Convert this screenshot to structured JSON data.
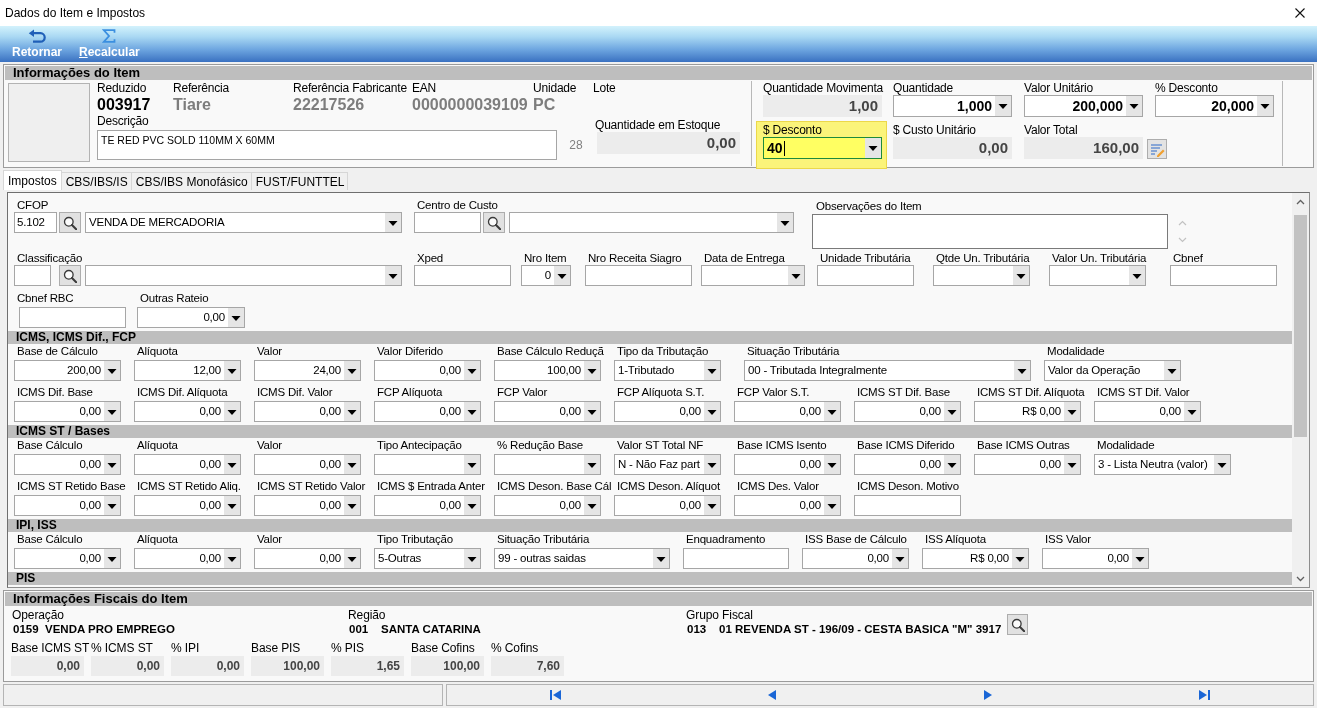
{
  "window": {
    "title": "Dados do Item e Impostos"
  },
  "toolbar": [
    {
      "kind": "return",
      "label": "Retornar",
      "accelerator": false
    },
    {
      "kind": "sum",
      "label": "Recalcular",
      "accelerator": true
    }
  ],
  "item_info": {
    "title": "Informações do Item",
    "identifiers": [
      {
        "label": "Reduzido",
        "value": "003917",
        "emphasis": true
      },
      {
        "label": "Referência",
        "value": "Tiare",
        "emphasis": false
      },
      {
        "label": "Referência Fabricante",
        "value": "22217526",
        "emphasis": false
      },
      {
        "label": "EAN",
        "value": "0000000039109",
        "emphasis": false
      },
      {
        "label": "Unidade",
        "value": "PC",
        "emphasis": false
      },
      {
        "label": "Lote"
      }
    ],
    "description": {
      "label": "Descrição",
      "value": "TE RED PVC SOLD 110MM X 60MM",
      "length": "28"
    },
    "stock": {
      "label": "Quantidade em Estoque",
      "value": "0,00"
    },
    "amounts": [
      {
        "kind": "readonly",
        "label": "Quantidade Movimenta",
        "value": "1,00",
        "focused": false
      },
      {
        "kind": "spin",
        "label": "Quantidade",
        "value": "1,000",
        "focused": false
      },
      {
        "kind": "spin",
        "label": "Valor Unitário",
        "value": "200,000",
        "focused": false
      },
      {
        "kind": "spin",
        "label": "% Desconto",
        "value": "20,000",
        "focused": false
      },
      {
        "kind": "spin",
        "label": "$ Desconto",
        "value": "40",
        "focused": true
      },
      {
        "kind": "readonly",
        "label": "$ Custo Unitário",
        "value": "0,00",
        "focused": false
      },
      {
        "kind": "total",
        "label": "Valor Total",
        "value": "160,00",
        "focused": false
      }
    ]
  },
  "tabs": [
    {
      "label": "Impostos",
      "selected": true
    },
    {
      "label": "CBS/IBS/IS",
      "selected": false
    },
    {
      "label": "CBS/IBS Monofásico",
      "selected": false
    },
    {
      "label": "FUST/FUNTTEL",
      "selected": false
    }
  ],
  "taxes": {
    "general": [
      [
        {
          "kind": "lookup",
          "label": "CFOP",
          "code": "5.102",
          "value": "VENDA DE MERCADORIA"
        },
        {
          "kind": "lookup",
          "label": "Centro de Custo"
        },
        {
          "kind": "memo",
          "label": "Observações do Item"
        }
      ],
      [
        {
          "kind": "lookup",
          "label": "Classificação"
        },
        {
          "kind": "input",
          "label": "Xped"
        },
        {
          "kind": "spin",
          "label": "Nro Item",
          "value": "0"
        },
        {
          "kind": "input",
          "label": "Nro Receita Siagro"
        },
        {
          "kind": "select",
          "label": "Data de Entrega"
        },
        {
          "kind": "input",
          "label": "Unidade Tributária"
        },
        {
          "kind": "select",
          "label": "Qtde Un. Tributária"
        },
        {
          "kind": "select",
          "label": "Valor Un. Tributária"
        },
        {
          "kind": "input",
          "label": "Cbnef"
        }
      ],
      [
        {
          "kind": "input",
          "label": "Cbnef RBC"
        },
        {
          "kind": "spin",
          "label": "Outras Rateio",
          "value": "0,00"
        }
      ]
    ],
    "sections": [
      {
        "title": "ICMS, ICMS Dif., FCP",
        "rows": [
          [
            {
              "kind": "spin",
              "label": "Base de Cálculo",
              "value": "200,00"
            },
            {
              "kind": "spin",
              "label": "Alíquota",
              "value": "12,00"
            },
            {
              "kind": "spin",
              "label": "Valor",
              "value": "24,00"
            },
            {
              "kind": "spin",
              "label": "Valor Diferido",
              "value": "0,00"
            },
            {
              "kind": "spin",
              "label": "Base Cálculo Reduçã",
              "value": "100,00"
            },
            {
              "kind": "select",
              "label": "Tipo da Tributação",
              "value": "1-Tributado"
            },
            {
              "kind": "select",
              "label": "Situação Tributária",
              "value": "00 - Tributada Integralmente"
            },
            {
              "kind": "select",
              "label": "Modalidade",
              "value": "Valor da Operação"
            }
          ],
          [
            {
              "kind": "spin",
              "label": "ICMS Dif. Base",
              "value": "0,00"
            },
            {
              "kind": "spin",
              "label": "ICMS Dif. Alíquota",
              "value": "0,00"
            },
            {
              "kind": "spin",
              "label": "ICMS Dif. Valor",
              "value": "0,00"
            },
            {
              "kind": "spin",
              "label": "FCP Alíquota",
              "value": "0,00"
            },
            {
              "kind": "spin",
              "label": "FCP Valor",
              "value": "0,00"
            },
            {
              "kind": "spin",
              "label": "FCP Alíquota S.T.",
              "value": "0,00"
            },
            {
              "kind": "spin",
              "label": "FCP Valor S.T.",
              "value": "0,00"
            },
            {
              "kind": "spin",
              "label": "ICMS ST Dif. Base",
              "value": "0,00"
            },
            {
              "kind": "spin",
              "label": "ICMS ST Dif. Alíquota",
              "value": "R$ 0,00"
            },
            {
              "kind": "spin",
              "label": "ICMS ST Dif. Valor",
              "value": "0,00"
            }
          ]
        ]
      },
      {
        "title": "ICMS ST / Bases",
        "rows": [
          [
            {
              "kind": "spin",
              "label": "Base Cálculo",
              "value": "0,00"
            },
            {
              "kind": "spin",
              "label": "Alíquota",
              "value": "0,00"
            },
            {
              "kind": "spin",
              "label": "Valor",
              "value": "0,00"
            },
            {
              "kind": "select",
              "label": "Tipo Antecipação"
            },
            {
              "kind": "select",
              "label": "% Redução Base"
            },
            {
              "kind": "select",
              "label": "Valor ST Total NF",
              "value": "N - Não Faz part"
            },
            {
              "kind": "spin",
              "label": "Base ICMS Isento",
              "value": "0,00"
            },
            {
              "kind": "spin",
              "label": "Base ICMS Diferido",
              "value": "0,00"
            },
            {
              "kind": "spin",
              "label": "Base ICMS Outras",
              "value": "0,00"
            },
            {
              "kind": "select",
              "label": "Modalidade",
              "value": "3 - Lista Neutra (valor)"
            }
          ],
          [
            {
              "kind": "spin",
              "label": "ICMS ST Retido Base",
              "value": "0,00"
            },
            {
              "kind": "spin",
              "label": "ICMS ST Retido Aliq.",
              "value": "0,00"
            },
            {
              "kind": "spin",
              "label": "ICMS ST Retido Valor",
              "value": "0,00"
            },
            {
              "kind": "spin",
              "label": "ICMS $ Entrada Anter",
              "value": "0,00"
            },
            {
              "kind": "spin",
              "label": "ICMS Deson. Base Cál",
              "value": "0,00"
            },
            {
              "kind": "spin",
              "label": "ICMS Deson. Alíquot",
              "value": "0,00"
            },
            {
              "kind": "spin",
              "label": "ICMS Des. Valor",
              "value": "0,00"
            },
            {
              "kind": "input",
              "label": "ICMS Deson. Motivo"
            }
          ]
        ]
      },
      {
        "title": "IPI, ISS",
        "rows": [
          [
            {
              "kind": "spin",
              "label": "Base Cálculo",
              "value": "0,00"
            },
            {
              "kind": "spin",
              "label": "Alíquota",
              "value": "0,00"
            },
            {
              "kind": "spin",
              "label": "Valor",
              "value": "0,00"
            },
            {
              "kind": "select",
              "label": "Tipo Tributação",
              "value": "5-Outras"
            },
            {
              "kind": "select",
              "label": "Situação Tributária",
              "value": "99 - outras saidas"
            },
            {
              "kind": "input",
              "label": "Enquadramento"
            },
            {
              "kind": "spin",
              "label": "ISS Base de Cálculo",
              "value": "0,00"
            },
            {
              "kind": "spin",
              "label": "ISS Alíquota",
              "value": "R$ 0,00"
            },
            {
              "kind": "spin",
              "label": "ISS Valor",
              "value": "0,00"
            }
          ]
        ]
      },
      {
        "title": "PIS"
      }
    ]
  },
  "fiscal": {
    "title": "Informações Fiscais do Item",
    "groups": [
      {
        "label": "Operação",
        "code": "0159",
        "value": "VENDA PRO EMPREGO",
        "lookup": false
      },
      {
        "label": "Região",
        "code": "001",
        "value": "SANTA CATARINA",
        "lookup": false
      },
      {
        "label": "Grupo Fiscal",
        "code": "013",
        "value": "01 REVENDA ST - 196/09 - CESTA BASICA \"M\" 3917",
        "lookup": true
      }
    ],
    "totals": [
      {
        "label": "Base ICMS ST",
        "value": "0,00"
      },
      {
        "label": "% ICMS ST",
        "value": "0,00"
      },
      {
        "label": "% IPI",
        "value": "0,00"
      },
      {
        "label": "Base PIS",
        "value": "100,00"
      },
      {
        "label": "% PIS",
        "value": "1,65"
      },
      {
        "label": "Base Cofins",
        "value": "100,00"
      },
      {
        "label": "% Cofins",
        "value": "7,60"
      }
    ]
  }
}
